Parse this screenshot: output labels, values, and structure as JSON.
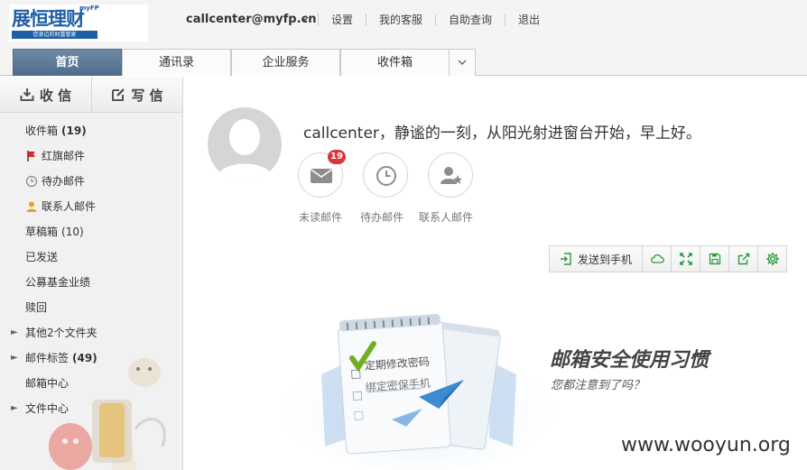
{
  "brand": {
    "name": "展恒理财",
    "sup": "myFP",
    "tagline": "您身边的财富管家"
  },
  "header": {
    "account": "callcenter@myfp.cn",
    "links": [
      "设置",
      "我的客服",
      "自助查询",
      "退出"
    ]
  },
  "tabs": [
    "首页",
    "通讯录",
    "企业服务",
    "收件箱"
  ],
  "sidebar": {
    "receive_label": "收 信",
    "compose_label": "写 信",
    "folders": [
      {
        "label": "收件箱",
        "count": "(19)"
      },
      {
        "label": "红旗邮件",
        "icon": "red-flag-icon"
      },
      {
        "label": "待办邮件",
        "icon": "clock-icon"
      },
      {
        "label": "联系人邮件",
        "icon": "contact-icon"
      },
      {
        "label": "草稿箱",
        "count": "(10)"
      },
      {
        "label": "已发送"
      },
      {
        "label": "公募基金业绩"
      },
      {
        "label": "赎回"
      },
      {
        "label": "其他2个文件夹"
      },
      {
        "label": "邮件标签",
        "count": "(49)"
      },
      {
        "label": "邮箱中心"
      },
      {
        "label": "文件中心"
      }
    ]
  },
  "main": {
    "greeting": "callcenter，静谧的一刻，从阳光射进窗台开始，早上好。",
    "quick_actions": [
      {
        "label": "未读邮件",
        "badge": "19",
        "icon": "envelope-icon"
      },
      {
        "label": "待办邮件",
        "icon": "clock-icon"
      },
      {
        "label": "联系人邮件",
        "icon": "contact-star-icon"
      }
    ],
    "toolbar": {
      "send_to_phone": "发送到手机",
      "icons": [
        "cloud-icon",
        "expand-icon",
        "save-icon",
        "share-icon",
        "settings-icon"
      ]
    },
    "promo": {
      "card_line1": "定期修改密码",
      "card_line2": "绑定密保手机",
      "title": "邮箱安全使用习惯",
      "subtitle": "您都注意到了吗？"
    },
    "watermark": "www.wooyun.org"
  },
  "colors": {
    "brand_blue": "#1f5fa8",
    "tab_active": "#5a7896",
    "accent_green": "#2e9a3c",
    "badge_red": "#d9383a"
  }
}
